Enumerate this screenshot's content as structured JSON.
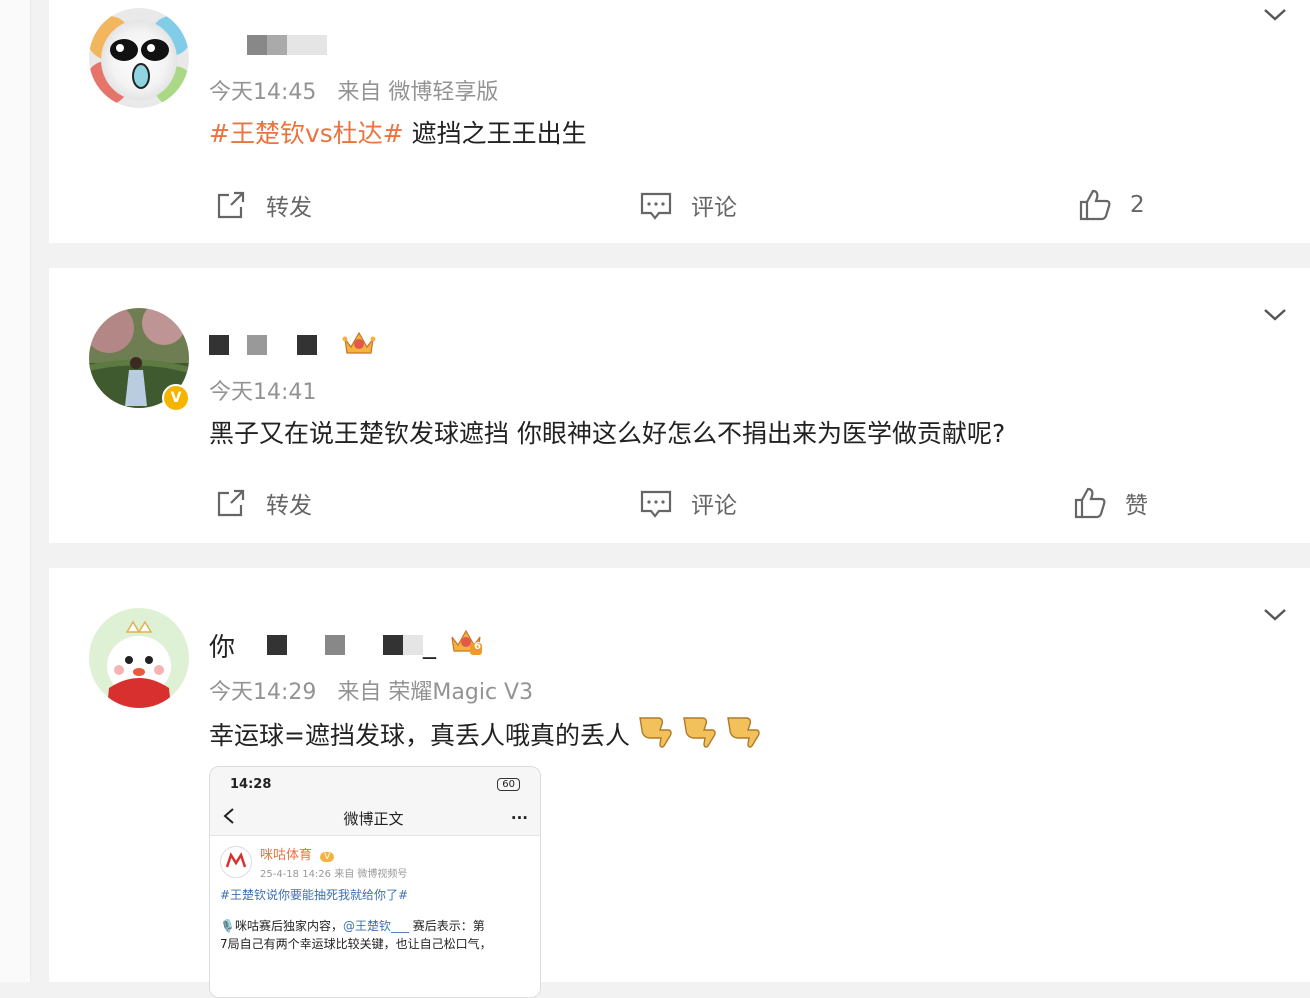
{
  "posts": [
    {
      "time": "今天14:45",
      "source": "来自 微博轻享版",
      "hashtag": "#王楚钦vs杜达#",
      "text": " 遮挡之王王出生",
      "actions": {
        "repost": "转发",
        "comment": "评论",
        "like": "2"
      }
    },
    {
      "time": "今天14:41",
      "source": "",
      "text": "黑子又在说王楚钦发球遮挡 你眼神这么好怎么不捐出来为医学做贡献呢?",
      "verified_mark": "V",
      "actions": {
        "repost": "转发",
        "comment": "评论",
        "like": "赞"
      }
    },
    {
      "username_visible": "你",
      "username_suffix": "_",
      "time": "今天14:29",
      "source": "来自 荣耀Magic V3",
      "text": "幸运球=遮挡发球，真丢人哦真的丢人",
      "crown_level": "6",
      "image": {
        "status_time": "14:28",
        "status_battery": "60",
        "nav_title": "微博正文",
        "nav_more": "···",
        "author": "咪咕体育",
        "author_badge": "V",
        "meta": "25-4-18 14:26  来自 微博视频号",
        "hashtag": "#王楚钦说你要能抽死我就给你了#",
        "line1_prefix": "🎙️咪咕赛后独家内容，",
        "line1_at": "@王楚钦___",
        "line1_suffix": " 赛后表示：第",
        "line2": "7局自己有两个幸运球比较关键，也让自己松口气，"
      }
    }
  ],
  "colors": {
    "hashtag": "#eb7340",
    "meta": "#939393",
    "background": "#f2f2f3"
  },
  "icons": [
    "chevron-down-icon",
    "repost-icon",
    "comment-icon",
    "like-icon",
    "crown-icon",
    "thumbs-down-icon",
    "verified-icon"
  ]
}
